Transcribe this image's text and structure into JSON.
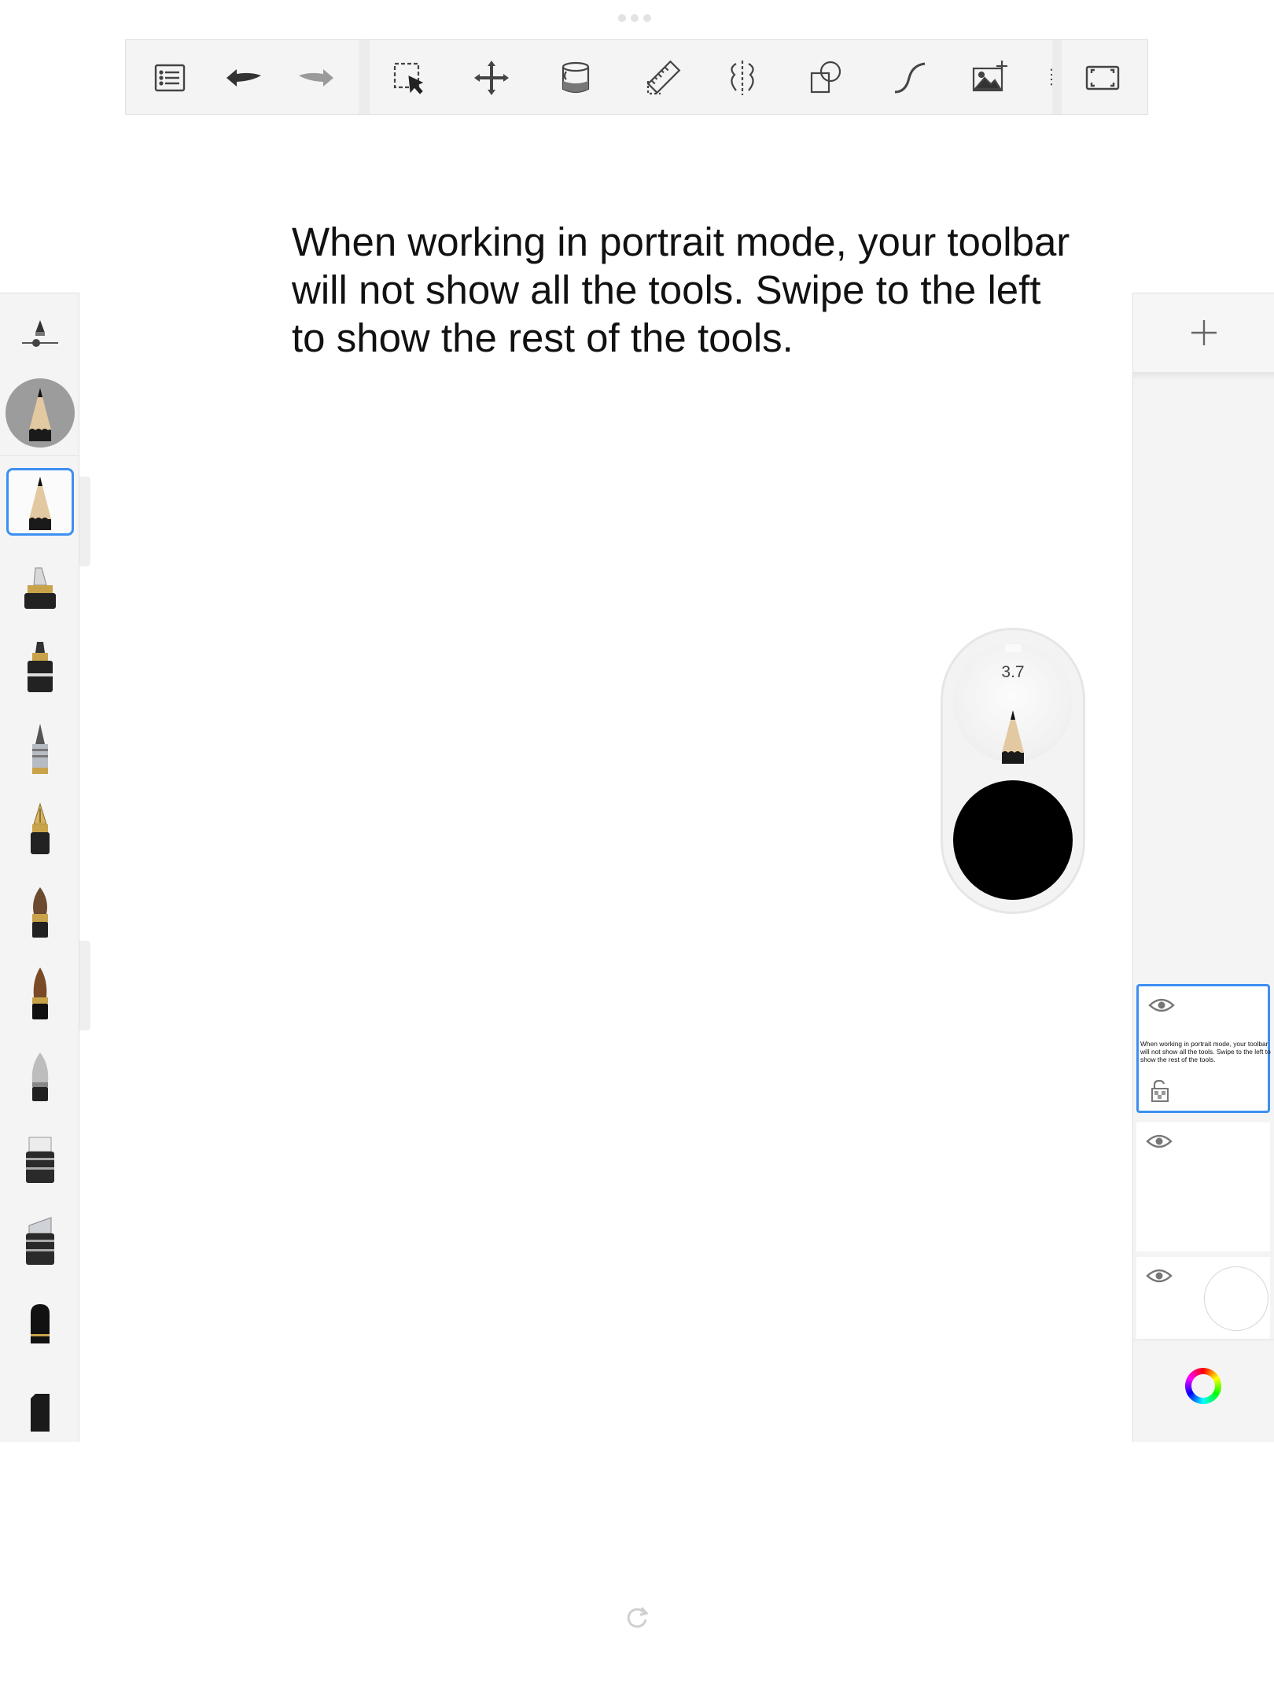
{
  "toolbar": {
    "buttons": [
      {
        "name": "list-menu-icon",
        "action": "Menu"
      },
      {
        "name": "undo-icon",
        "action": "Undo"
      },
      {
        "name": "redo-icon",
        "action": "Redo"
      },
      {
        "name": "selection-icon",
        "action": "Select"
      },
      {
        "name": "transform-move-icon",
        "action": "Transform"
      },
      {
        "name": "fill-bucket-icon",
        "action": "Fill"
      },
      {
        "name": "ruler-icon",
        "action": "Ruler"
      },
      {
        "name": "symmetry-icon",
        "action": "Symmetry"
      },
      {
        "name": "shapes-icon",
        "action": "Shapes"
      },
      {
        "name": "stroke-curve-icon",
        "action": "Stroke"
      },
      {
        "name": "add-image-icon",
        "action": "Add Image"
      },
      {
        "name": "fullscreen-icon",
        "action": "Fullscreen"
      }
    ]
  },
  "canvas": {
    "instruction_text": "When working in portrait mode, your toolbar will not show all the tools. Swipe to the left to show the rest of the tools."
  },
  "brush_panel": {
    "current_brush": "pencil",
    "brushes": [
      "pencil",
      "marker",
      "ink-pen",
      "ballpoint-pen",
      "fountain-pen",
      "paint-brush",
      "ink-brush",
      "airbrush",
      "eraser-flat",
      "eraser-angled",
      "smudge",
      "blender"
    ],
    "selected_index": 0
  },
  "puck": {
    "brush_size": "3.7",
    "color": "#000000"
  },
  "layers": {
    "add_label": "+",
    "items": [
      {
        "type": "text-layer",
        "thumbnail_text": "When working in portrait mode, your toolbar will not show all the tools. Swipe to the left to show the rest of the tools.",
        "selected": true
      },
      {
        "type": "empty-layer",
        "selected": false
      },
      {
        "type": "background-layer",
        "selected": false
      }
    ]
  },
  "colors": {
    "accent": "#3d8ff2",
    "panel": "#f4f4f4",
    "puck_color": "#000000"
  }
}
